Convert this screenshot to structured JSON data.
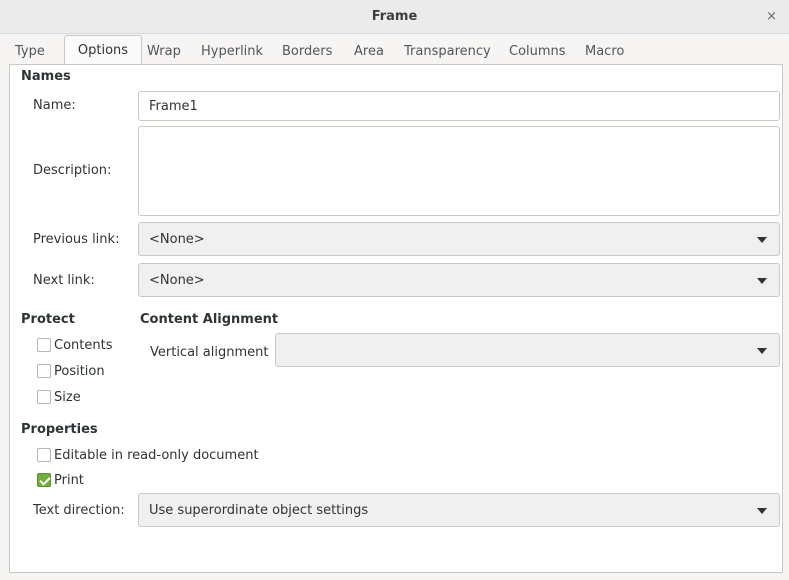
{
  "window": {
    "title": "Frame",
    "close_glyph": "×"
  },
  "tabs": [
    "Type",
    "Options",
    "Wrap",
    "Hyperlink",
    "Borders",
    "Area",
    "Transparency",
    "Columns",
    "Macro"
  ],
  "active_tab": "Options",
  "names": {
    "heading": "Names",
    "name_label": "Name:",
    "name_value": "Frame1",
    "description_label": "Description:",
    "description_value": "",
    "previous_link_label": "Previous link:",
    "previous_link_value": "<None>",
    "next_link_label": "Next link:",
    "next_link_value": "<None>"
  },
  "protect": {
    "heading": "Protect",
    "contents": {
      "label": "Contents",
      "checked": false
    },
    "position": {
      "label": "Position",
      "checked": false
    },
    "size": {
      "label": "Size",
      "checked": false
    }
  },
  "content_alignment": {
    "heading": "Content Alignment",
    "vertical_label": "Vertical alignment",
    "vertical_value": ""
  },
  "properties": {
    "heading": "Properties",
    "editable": {
      "label": "Editable in read-only document",
      "checked": false
    },
    "print": {
      "label": "Print",
      "checked": true
    },
    "text_direction_label": "Text direction:",
    "text_direction_value": "Use superordinate object settings"
  },
  "colors": {
    "checked": "#73ad3c",
    "accent_border": "#cdc7c2"
  }
}
